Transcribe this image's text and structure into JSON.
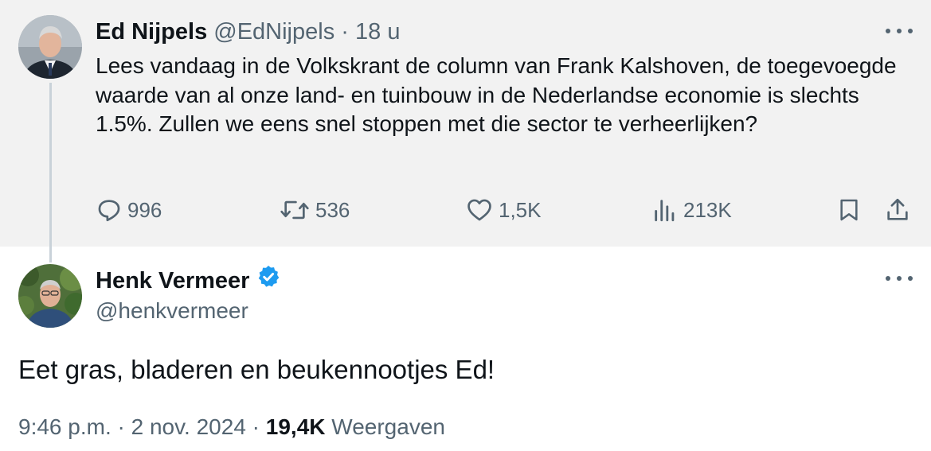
{
  "parent_tweet": {
    "name": "Ed Nijpels",
    "handle": "@EdNijpels",
    "separator": "·",
    "time": "18 u",
    "text": "Lees vandaag in de Volkskrant de column van Frank Kalshoven, de toegevoegde waarde van al onze land- en tuinbouw in de Nederlandse economie is slechts 1.5%. Zullen we eens snel stoppen met die sector te verheerlijken?",
    "actions": {
      "replies": "996",
      "retweets": "536",
      "likes": "1,5K",
      "views": "213K"
    },
    "icons": [
      "reply-icon",
      "retweet-icon",
      "heart-icon",
      "views-icon",
      "bookmark-icon",
      "share-icon",
      "more-icon"
    ]
  },
  "reply_tweet": {
    "name": "Henk Vermeer",
    "handle": "@henkvermeer",
    "verified": true,
    "text": "Eet gras, bladeren en beukennootjes Ed!",
    "time": "9:46 p.m.",
    "sep1": "·",
    "date": "2 nov. 2024",
    "sep2": "·",
    "views_count": "19,4K",
    "views_label": "Weergaven"
  },
  "colors": {
    "parent_bg": "#f2f2f2",
    "text": "#0f1419",
    "secondary": "#536471",
    "verified": "#1d9bf0",
    "thread_line": "#c9d2d9"
  }
}
